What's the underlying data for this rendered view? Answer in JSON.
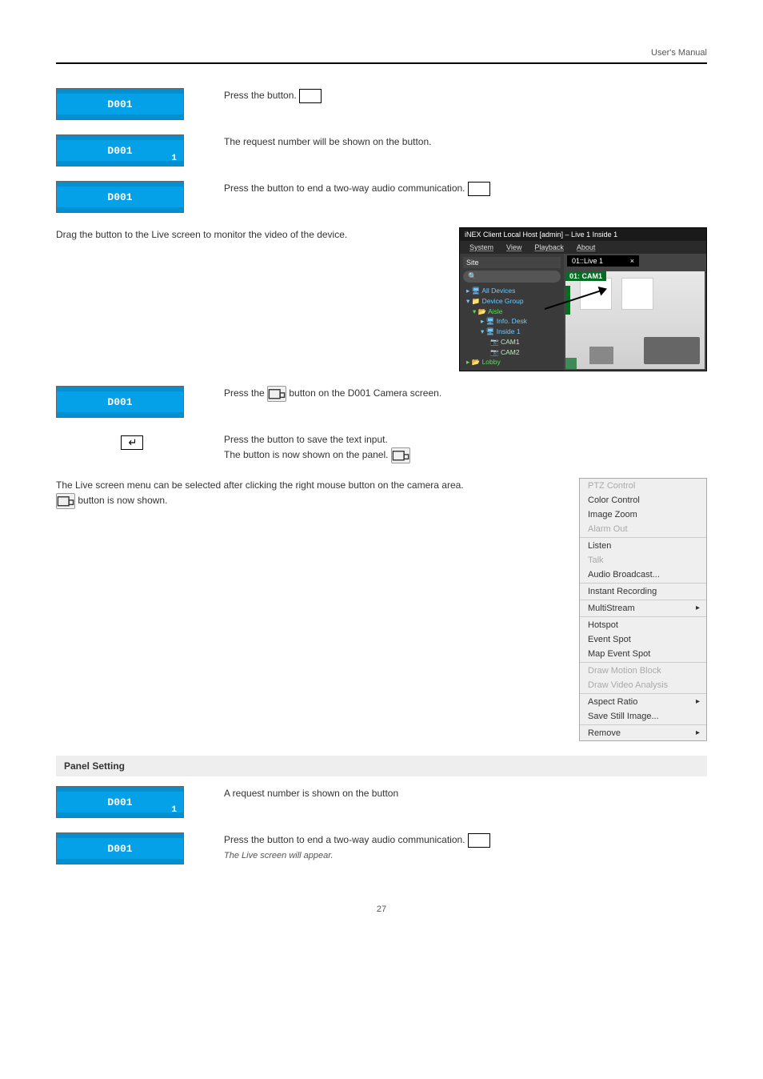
{
  "header": {
    "doc_title": "User's Manual"
  },
  "blk": {
    "d001": "D001",
    "one": "1"
  },
  "para": {
    "a": "Press the       button.",
    "b": "The request number will be shown on the button.",
    "c": "Press the       button to end a two-way audio communication.",
    "d": "Drag the button to the Live screen to monitor the video of the device.",
    "e_lead": "Press the ",
    "e_tail": " button on the D001 Camera screen.",
    "enter_lead": "Press the ",
    "enter_mid": " button to save the text input.",
    "enter_tail": "The button      is now shown on the panel."
  },
  "ss": {
    "title": "iNEX Client Local Host [admin] – Live 1 Inside 1",
    "menu": [
      "System",
      "View",
      "Playback",
      "About"
    ],
    "sidebar_label": "Site",
    "search_ph": "🔍",
    "tree": {
      "all": "All Devices",
      "dg": "Device Group",
      "aisle": "Aisle",
      "info": "Info. Desk",
      "inside": "Inside 1",
      "cam1": "CAM1",
      "cam2": "CAM2",
      "lobby": "Lobby"
    },
    "tab": "01::Live 1",
    "cam_label": "01: CAM1"
  },
  "screen_para": {
    "lead": "The Live screen menu can be selected after clicking the right mouse button on the camera area.",
    "tail": " button is now shown."
  },
  "ctx": {
    "ptz": "PTZ Control",
    "color": "Color Control",
    "zoom": "Image Zoom",
    "alarm": "Alarm Out",
    "listen": "Listen",
    "talk": "Talk",
    "audio": "Audio Broadcast...",
    "instant": "Instant Recording",
    "multi": "MultiStream",
    "hotspot": "Hotspot",
    "event": "Event Spot",
    "mapevent": "Map Event Spot",
    "motion": "Draw Motion Block",
    "analysis": "Draw Video Analysis",
    "aspect": "Aspect Ratio",
    "save": "Save Still Image...",
    "remove": "Remove"
  },
  "section": {
    "title": "Panel Setting"
  },
  "panel_para": {
    "a": "A request number is shown on the button",
    "b": "Press the       button to end a two-way audio communication.",
    "c": "The Live screen will appear."
  },
  "footer": {
    "page": "27"
  }
}
